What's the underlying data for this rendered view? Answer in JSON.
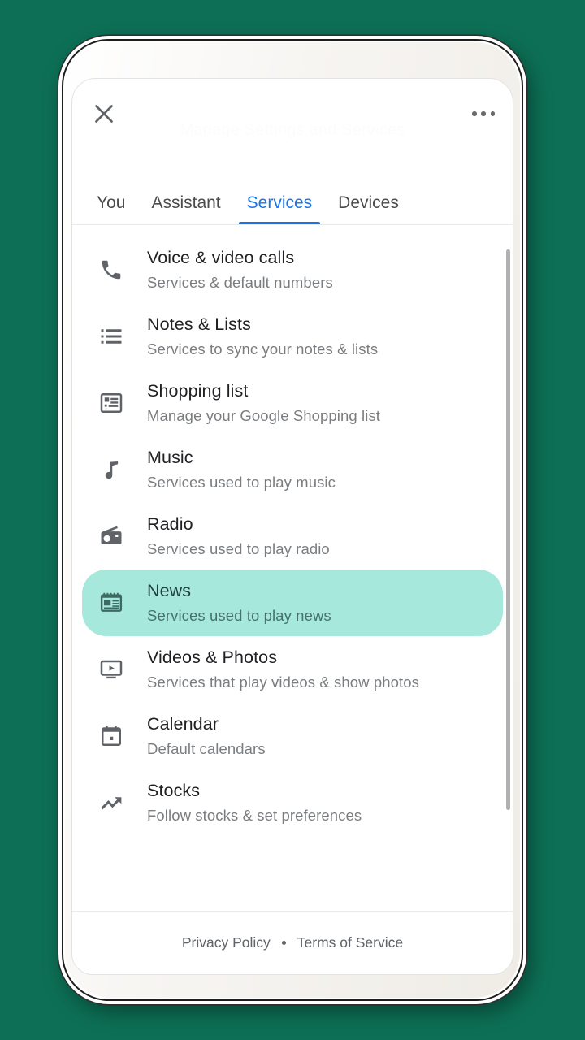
{
  "background_color": "#0d7056",
  "accent_color": "#1a73e8",
  "highlight_color": "#a7e8dc",
  "header": {
    "close_label": "close-icon",
    "overflow_label": "more-options",
    "watermark": "Manage Settings and Services"
  },
  "tabs": [
    {
      "label": "You",
      "active": false
    },
    {
      "label": "Assistant",
      "active": false
    },
    {
      "label": "Services",
      "active": true
    },
    {
      "label": "Devices",
      "active": false
    }
  ],
  "services": [
    {
      "icon": "phone-icon",
      "title": "Voice & video calls",
      "subtitle": "Services & default numbers",
      "highlighted": false
    },
    {
      "icon": "list-icon",
      "title": "Notes & Lists",
      "subtitle": "Services to sync your notes & lists",
      "highlighted": false
    },
    {
      "icon": "shopping-list-icon",
      "title": "Shopping list",
      "subtitle": "Manage your Google Shopping list",
      "highlighted": false
    },
    {
      "icon": "music-note-icon",
      "title": "Music",
      "subtitle": "Services used to play music",
      "highlighted": false
    },
    {
      "icon": "radio-icon",
      "title": "Radio",
      "subtitle": "Services used to play radio",
      "highlighted": false
    },
    {
      "icon": "news-icon",
      "title": "News",
      "subtitle": "Services used to play news",
      "highlighted": true
    },
    {
      "icon": "video-icon",
      "title": "Videos & Photos",
      "subtitle": "Services that play videos & show photos",
      "highlighted": false
    },
    {
      "icon": "calendar-icon",
      "title": "Calendar",
      "subtitle": "Default calendars",
      "highlighted": false
    },
    {
      "icon": "trending-up-icon",
      "title": "Stocks",
      "subtitle": "Follow stocks & set preferences",
      "highlighted": false
    }
  ],
  "footer": {
    "privacy_label": "Privacy Policy",
    "separator": "•",
    "terms_label": "Terms of Service"
  }
}
